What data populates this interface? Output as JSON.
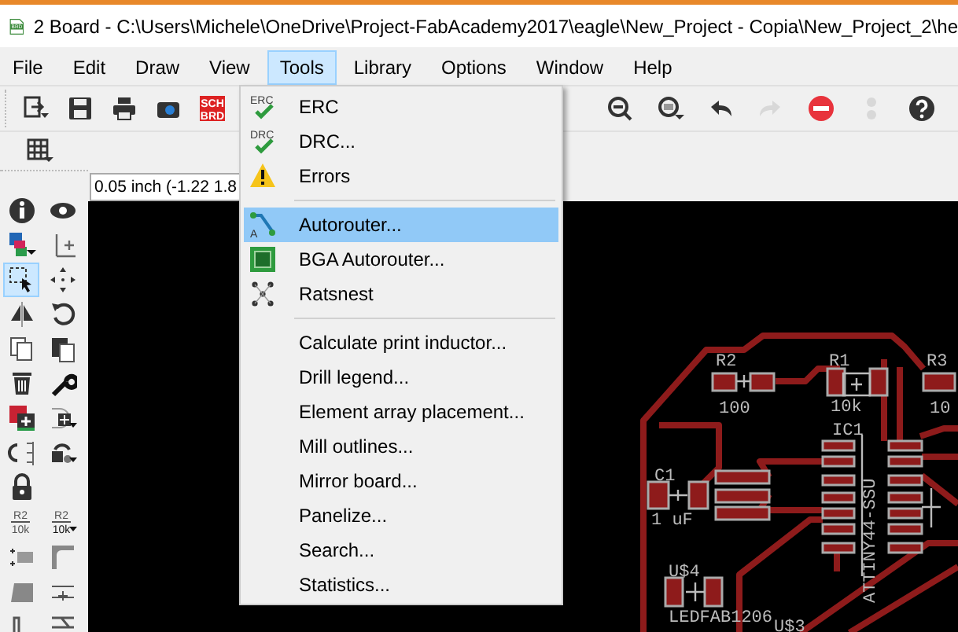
{
  "window": {
    "title": "2 Board - C:\\Users\\Michele\\OneDrive\\Project-FabAcademy2017\\eagle\\New_Project - Copia\\New_Project_2\\he",
    "icon_text": "BRD"
  },
  "menu_bar": [
    {
      "label": "File",
      "selected": false
    },
    {
      "label": "Edit",
      "selected": false
    },
    {
      "label": "Draw",
      "selected": false
    },
    {
      "label": "View",
      "selected": false
    },
    {
      "label": "Tools",
      "selected": true
    },
    {
      "label": "Library",
      "selected": false
    },
    {
      "label": "Options",
      "selected": false
    },
    {
      "label": "Window",
      "selected": false
    },
    {
      "label": "Help",
      "selected": false
    }
  ],
  "toolbar_left": [
    {
      "kind": "import",
      "disabled": false
    },
    {
      "kind": "save",
      "disabled": false
    },
    {
      "kind": "print",
      "disabled": false
    },
    {
      "kind": "camera",
      "disabled": false
    },
    {
      "kind": "switch",
      "top": "SCH",
      "bottom": "BRD",
      "disabled": false
    }
  ],
  "toolbar_right": [
    {
      "kind": "zoom-out",
      "disabled": false
    },
    {
      "kind": "zoom-select",
      "disabled": false
    },
    {
      "kind": "undo",
      "disabled": false
    },
    {
      "kind": "redo",
      "disabled": true
    },
    {
      "kind": "stop",
      "disabled": false
    },
    {
      "kind": "dots",
      "disabled": true
    },
    {
      "kind": "help",
      "disabled": false
    }
  ],
  "toolbar_2": [
    {
      "kind": "grid"
    }
  ],
  "coordinate_field": {
    "value": "0.05 inch (-1.22 1.8"
  },
  "toolbox": [
    [
      {
        "kind": "info",
        "selected": false
      },
      {
        "kind": "eye",
        "selected": false
      }
    ],
    [
      {
        "kind": "layers",
        "selected": false
      },
      {
        "kind": "mark",
        "selected": false
      }
    ],
    [
      {
        "kind": "select",
        "selected": true
      },
      {
        "kind": "move",
        "selected": false
      }
    ],
    [
      {
        "kind": "mirror",
        "selected": false
      },
      {
        "kind": "rotate",
        "selected": false
      }
    ],
    [
      {
        "kind": "copy",
        "selected": false
      },
      {
        "kind": "paste",
        "selected": false
      }
    ],
    [
      {
        "kind": "delete",
        "selected": false
      },
      {
        "kind": "wrench",
        "selected": false
      }
    ],
    [
      {
        "kind": "add",
        "selected": false
      },
      {
        "kind": "replace",
        "selected": false
      }
    ],
    [
      {
        "kind": "swap",
        "selected": false
      },
      {
        "kind": "lock-rotate",
        "selected": false
      }
    ],
    [
      {
        "kind": "lock",
        "selected": false
      }
    ],
    [
      {
        "kind": "name",
        "top": "R2",
        "bottom": "10k",
        "selected": false
      },
      {
        "kind": "value",
        "top": "R2",
        "bottom": "10k",
        "selected": false
      }
    ],
    [
      {
        "kind": "split",
        "selected": false
      },
      {
        "kind": "miter",
        "selected": false
      }
    ],
    [
      {
        "kind": "slice",
        "selected": false
      },
      {
        "kind": "optimize",
        "selected": false
      }
    ],
    [
      {
        "kind": "meander",
        "selected": false
      },
      {
        "kind": "route",
        "selected": false
      }
    ]
  ],
  "tools_menu": [
    {
      "kind": "check",
      "icon_text": "ERC",
      "label": "ERC",
      "selected": false
    },
    {
      "kind": "check",
      "icon_text": "DRC",
      "label": "DRC...",
      "selected": false
    },
    {
      "kind": "warning",
      "label": "Errors",
      "selected": false
    },
    {
      "kind": "separator"
    },
    {
      "kind": "route",
      "icon_text": "A",
      "label": "Autorouter...",
      "selected": true
    },
    {
      "kind": "chip",
      "label": "BGA Autorouter...",
      "selected": false
    },
    {
      "kind": "ratsnest",
      "label": "Ratsnest",
      "selected": false
    },
    {
      "kind": "separator"
    },
    {
      "kind": "item",
      "label": "Calculate print inductor...",
      "selected": false
    },
    {
      "kind": "item",
      "label": "Drill legend...",
      "selected": false
    },
    {
      "kind": "item",
      "label": "Element array placement...",
      "selected": false
    },
    {
      "kind": "item",
      "label": "Mill outlines...",
      "selected": false
    },
    {
      "kind": "item",
      "label": "Mirror board...",
      "selected": false
    },
    {
      "kind": "item",
      "label": "Panelize...",
      "selected": false
    },
    {
      "kind": "item",
      "label": "Search...",
      "selected": false
    },
    {
      "kind": "item",
      "label": "Statistics...",
      "selected": false
    }
  ],
  "board": {
    "parts": [
      {
        "name": "R2",
        "value": "100"
      },
      {
        "name": "R1",
        "value": "10k"
      },
      {
        "name": "R3",
        "value": "10"
      },
      {
        "name": "IC1",
        "value": "ATTINY44-SSU"
      },
      {
        "name": "C1",
        "value": "1 uF"
      },
      {
        "name": "U$4",
        "value": "LEDFAB1206"
      },
      {
        "name": "U$3"
      }
    ]
  }
}
